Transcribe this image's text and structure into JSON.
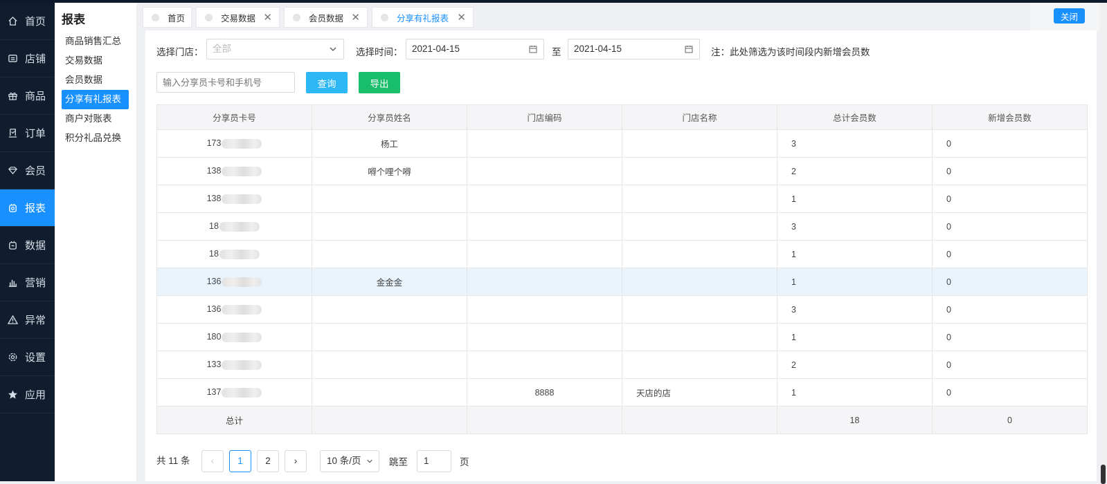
{
  "nav": {
    "items": [
      {
        "label": "首页",
        "icon": "home-icon"
      },
      {
        "label": "店铺",
        "icon": "store-icon"
      },
      {
        "label": "商品",
        "icon": "gift-icon"
      },
      {
        "label": "订单",
        "icon": "order-icon"
      },
      {
        "label": "会员",
        "icon": "diamond-icon"
      },
      {
        "label": "报表",
        "icon": "report-icon",
        "active": true
      },
      {
        "label": "数据",
        "icon": "data-icon"
      },
      {
        "label": "营销",
        "icon": "bar-chart-icon"
      },
      {
        "label": "异常",
        "icon": "warning-icon"
      },
      {
        "label": "设置",
        "icon": "gear-icon"
      },
      {
        "label": "应用",
        "icon": "star-icon"
      }
    ]
  },
  "submenu": {
    "title": "报表",
    "items": [
      "商品销售汇总",
      "交易数据",
      "会员数据",
      "分享有礼报表",
      "商户对账表",
      "积分礼品兑换"
    ],
    "active_index": 3
  },
  "tabs": [
    {
      "label": "首页",
      "closable": false
    },
    {
      "label": "交易数据",
      "closable": true
    },
    {
      "label": "会员数据",
      "closable": true
    },
    {
      "label": "分享有礼报表",
      "closable": true,
      "active": true
    }
  ],
  "close_label": "关闭",
  "close_x": "✕",
  "filters": {
    "store_label": "选择门店：",
    "store_value": "全部",
    "time_label": "选择时间：",
    "start_date": "2021-04-15",
    "to_label": "至",
    "end_date": "2021-04-15",
    "note": "注：此处筛选为该时间段内新增会员数",
    "search_placeholder": "输入分享员卡号和手机号",
    "query_label": "查询",
    "export_label": "导出"
  },
  "table": {
    "columns": [
      "分享员卡号",
      "分享员姓名",
      "门店编码",
      "门店名称",
      "总计会员数",
      "新增会员数"
    ],
    "rows": [
      {
        "card": "173",
        "name": "杨工",
        "store_code": "",
        "store_name": "",
        "total": "3",
        "new": "0"
      },
      {
        "card": "138",
        "name": "嘚个哩个嘚",
        "store_code": "",
        "store_name": "",
        "total": "2",
        "new": "0"
      },
      {
        "card": "138",
        "name": "",
        "store_code": "",
        "store_name": "",
        "total": "1",
        "new": "0"
      },
      {
        "card": "18",
        "name": "",
        "store_code": "",
        "store_name": "",
        "total": "3",
        "new": "0"
      },
      {
        "card": "18",
        "name": "",
        "store_code": "",
        "store_name": "",
        "total": "1",
        "new": "0"
      },
      {
        "card": "136",
        "name": "金金金",
        "store_code": "",
        "store_name": "",
        "total": "1",
        "new": "0",
        "highlight": true
      },
      {
        "card": "136",
        "name": "",
        "store_code": "",
        "store_name": "",
        "total": "3",
        "new": "0"
      },
      {
        "card": "180",
        "name": "",
        "store_code": "",
        "store_name": "",
        "total": "1",
        "new": "0"
      },
      {
        "card": "133",
        "name": "",
        "store_code": "",
        "store_name": "",
        "total": "2",
        "new": "0"
      },
      {
        "card": "137",
        "name": "",
        "store_code": "8888",
        "store_name": "天店的店",
        "total": "1",
        "new": "0"
      }
    ],
    "summary": {
      "label": "总计",
      "total": "18",
      "new": "0"
    }
  },
  "pagination": {
    "total_text": "共 11 条",
    "prev": "‹",
    "pages": [
      "1",
      "2"
    ],
    "current": "1",
    "next": "›",
    "page_size": "10 条/页",
    "jump_label": "跳至",
    "jump_value": "1",
    "page_unit": "页"
  },
  "colors": {
    "primary": "#1890ff",
    "export": "#19be6b",
    "query": "#2db7f5",
    "nav_bg": "#0f1d2e"
  }
}
